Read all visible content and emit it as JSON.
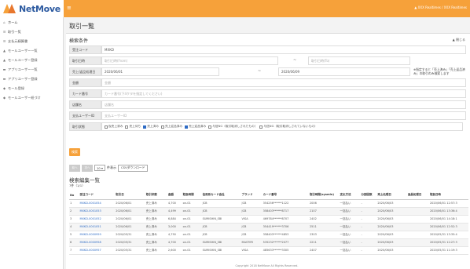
{
  "header": {
    "logo": "NetMove",
    "menu_icon": "hamburger-icon",
    "user": "▲ XXX Realtimes / XXX Realtimes"
  },
  "sidebar": {
    "items": [
      {
        "icon": "home-icon",
        "label": "ホーム"
      },
      {
        "icon": "list-icon",
        "label": "取引一覧"
      },
      {
        "icon": "report-icon",
        "label": "支払元精算書"
      },
      {
        "icon": "user-icon",
        "label": "モールユーザー一覧"
      },
      {
        "icon": "user-icon",
        "label": "モールユーザー登録"
      },
      {
        "icon": "card-icon",
        "label": "アプリユーザー一覧"
      },
      {
        "icon": "card-icon",
        "label": "アプリユーザー登録"
      },
      {
        "icon": "store-icon",
        "label": "モール登録"
      },
      {
        "icon": "store-icon",
        "label": "モールユーザー紐づけ"
      }
    ]
  },
  "page": {
    "title": "取引一覧",
    "section_title": "検索条件",
    "close_label": "▲ 閉じる"
  },
  "form": {
    "shop_code": {
      "label": "受注コード",
      "value": "MXKD"
    },
    "order_date": {
      "label": "取引日時",
      "from_placeholder": "取引日時(From)",
      "to_placeholder": "取引日時(To)"
    },
    "sales_date": {
      "label": "売上/返品処理日",
      "from_value": "2020/06/01",
      "to_value": "2020/06/09",
      "note": "※指定すると「売上済み」「売上返品済み」の取引のみ検索します"
    },
    "amount": {
      "label": "金額",
      "placeholder": "金額"
    },
    "card_no": {
      "label": "カード番号",
      "placeholder": "カード番号(下4ケタを指定してください)"
    },
    "shop_name": {
      "label": "店舗名",
      "placeholder": "店舗名"
    },
    "user_id": {
      "label": "支払ユーザーID",
      "placeholder": "支払ユーザーID"
    },
    "status": {
      "label": "取引状態",
      "options": [
        {
          "label": "仮売上済み",
          "checked": false
        },
        {
          "label": "売上待ち",
          "checked": false
        },
        {
          "label": "売上済み",
          "checked": true
        },
        {
          "label": "売上返品済み",
          "checked": false
        },
        {
          "label": "売上返品済み",
          "checked": true
        },
        {
          "label": "与信NG（取引取消しされたもの）",
          "checked": false
        },
        {
          "label": "与信NG（取引取消しされていないもの）",
          "checked": false
        }
      ]
    },
    "search_label": "検索"
  },
  "list": {
    "prev_label": "前へ",
    "next_label": "次へ",
    "per_page": "10 ▾",
    "per_page_suffix": "件表示",
    "csv_label": "CSVダウンロード",
    "title": "検索編集一覧",
    "count": "7件（1/1）"
  },
  "table": {
    "headers": [
      "No",
      "受注コード",
      "取引日",
      "取引状態",
      "金額",
      "取扱時間",
      "信用系カード会社",
      "ブランド",
      "カード番号",
      "取引時間(sysmin)",
      "支払方法",
      "分割回数",
      "売上処理日",
      "返品処理日",
      "取扱日時"
    ],
    "rows": [
      [
        "1",
        "MXKD-0001054",
        "2020/06/01",
        "売上済み",
        "4,700",
        "on-01",
        "JCB",
        "JCB",
        "354256******1122",
        "2006",
        "一括払い",
        "-",
        "2020/06/03",
        "",
        "2020/06/01 12:57:3"
      ],
      [
        "2",
        "MXKD-0001053",
        "2020/06/01",
        "売上済み",
        "4,499",
        "on-01",
        "JCB",
        "JCB",
        "358403******8717",
        "2107",
        "一括払い",
        "-",
        "2020/06/03",
        "",
        "2020/06/01 13:36:4"
      ],
      [
        "3",
        "MXKD-0001052",
        "2020/06/01",
        "売上済み",
        "6,884",
        "on-01",
        "SUMISHIN_SBI",
        "VISA",
        "469784******8707",
        "2402",
        "一括払い",
        "-",
        "2020/06/03",
        "",
        "2020/06/01 14:18:1"
      ],
      [
        "4",
        "MXKD-0001051",
        "2020/06/01",
        "売上済み",
        "3,000",
        "on-01",
        "JCB",
        "JCB",
        "354419******3706",
        "2511",
        "一括払い",
        "-",
        "2020/06/03",
        "",
        "2020/06/01 12:52:3"
      ],
      [
        "5",
        "MXKD-0000959",
        "2020/05/31",
        "売上済み",
        "4,750",
        "on-01",
        "JCB",
        "JCB",
        "358403******4853",
        "2303",
        "一括払い",
        "-",
        "2020/06/03",
        "",
        "2020/05/31 13:35:4"
      ],
      [
        "6",
        "MXKD-0000958",
        "2020/05/31",
        "売上済み",
        "4,700",
        "on-01",
        "SUMISHIN_SBI",
        "MASTER",
        "535232******2077",
        "2211",
        "一括払い",
        "-",
        "2020/06/03",
        "",
        "2020/05/31 12:27:3"
      ],
      [
        "7",
        "MXKD-0000957",
        "2020/05/31",
        "売上済み",
        "2,600",
        "on-01",
        "SUMISHIN_SBI",
        "VISA",
        "485633******3305",
        "2407",
        "一括払い",
        "-",
        "2020/06/03",
        "",
        "2020/05/31 11:19:3"
      ]
    ]
  },
  "footer": {
    "text": "Copyright 2018 NetMove All Rights Reserved."
  },
  "colors": {
    "accent": "#f6a13a",
    "link": "#2e6bc4",
    "logo": "#2c5aa0"
  }
}
